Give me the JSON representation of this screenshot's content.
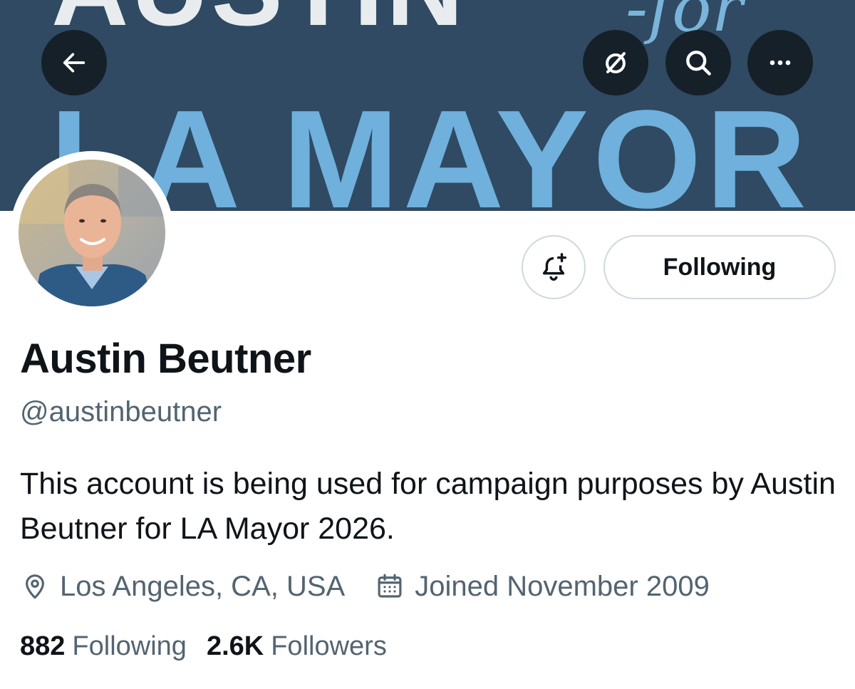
{
  "banner": {
    "line_top": "AUSTIN",
    "line_for": "-for",
    "line_bottom": "LA MAYOR"
  },
  "header_buttons": {
    "back": "arrow-left-icon",
    "grok": "slashed-circle-icon",
    "search": "search-icon",
    "more": "more-dots-icon"
  },
  "profile": {
    "display_name": "Austin Beutner",
    "handle": "@austinbeutner",
    "bio": "This account is being used for campaign purposes by Austin Beutner for LA Mayor 2026.",
    "location": "Los Angeles, CA, USA",
    "joined": "Joined November 2009"
  },
  "actions": {
    "notify_icon": "bell-plus-icon",
    "follow_label": "Following"
  },
  "stats": {
    "following_count": "882",
    "following_label": "Following",
    "followers_count": "2.6K",
    "followers_label": "Followers"
  },
  "colors": {
    "banner_bg": "#2f4a62",
    "banner_accent": "#6fb0dc",
    "secondary_text": "#536471",
    "border": "#cfd9de"
  }
}
